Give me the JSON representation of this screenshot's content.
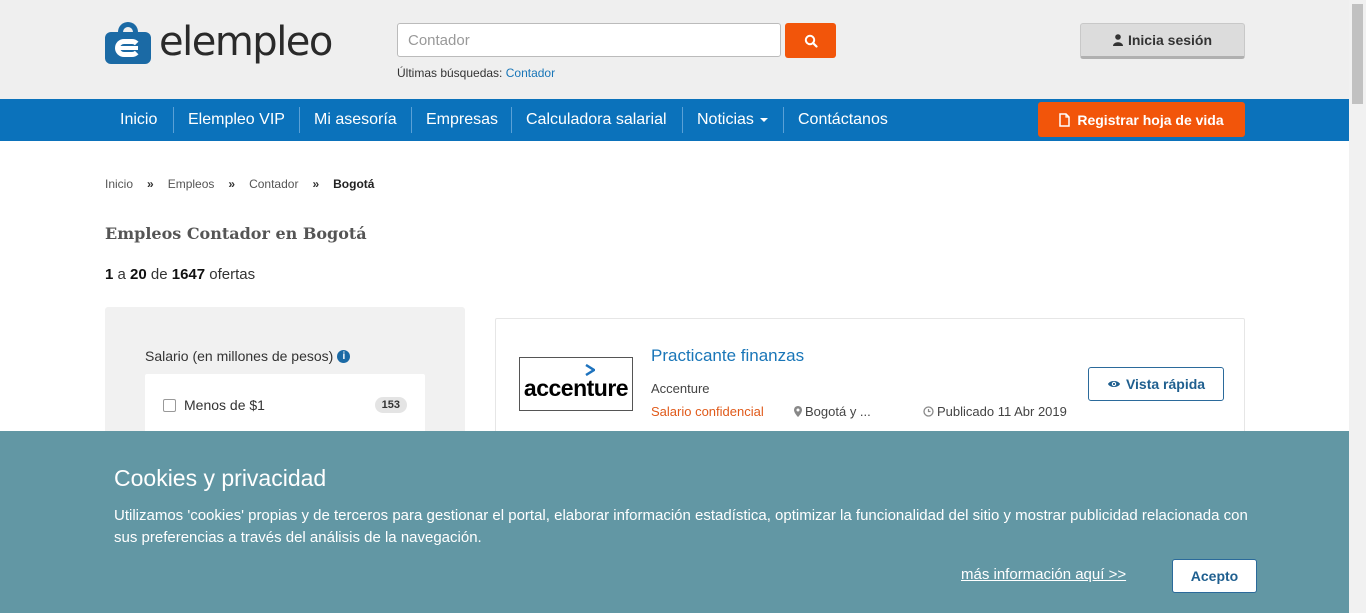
{
  "header": {
    "logo_text": "elempleo",
    "search_placeholder": "Contador",
    "recent_label": "Últimas búsquedas:",
    "recent_link": "Contador",
    "login_label": "Inicia sesión"
  },
  "nav": {
    "items": [
      {
        "label": "Inicio"
      },
      {
        "label": "Elempleo VIP"
      },
      {
        "label": "Mi asesoría"
      },
      {
        "label": "Empresas"
      },
      {
        "label": "Calculadora salarial"
      },
      {
        "label": "Noticias"
      },
      {
        "label": "Contáctanos"
      }
    ],
    "cv_button": "Registrar hoja de vida"
  },
  "breadcrumb": {
    "items": [
      "Inicio",
      "Empleos",
      "Contador",
      "Bogotá"
    ],
    "separator": "»"
  },
  "page": {
    "title": "Empleos Contador en Bogotá",
    "count_from": "1",
    "count_a": "a",
    "count_to": "20",
    "count_de": "de",
    "count_total": "1647",
    "count_suffix": "ofertas"
  },
  "filters": {
    "salary_title": "Salario (en millones de pesos)",
    "options": [
      {
        "label": "Menos de $1",
        "count": "153"
      }
    ]
  },
  "job": {
    "company_logo_text": "accenture",
    "title": "Practicante finanzas",
    "company": "Accenture",
    "salary": "Salario confidencial",
    "location": "Bogotá y ...",
    "date": "Publicado 11 Abr 2019",
    "quick_view": "Vista rápida"
  },
  "cookies": {
    "title": "Cookies y privacidad",
    "text": "Utilizamos 'cookies' propias y de terceros para gestionar el portal, elaborar información estadística, optimizar la funcionalidad del sitio y mostrar publicidad relacionada con sus preferencias a través del análisis de la navegación.",
    "more_link": "más información aquí >>",
    "accept": "Acepto"
  },
  "colors": {
    "brand_blue": "#0b72bb",
    "accent_orange": "#f2550a",
    "cookie_bg": "#6297a4"
  }
}
